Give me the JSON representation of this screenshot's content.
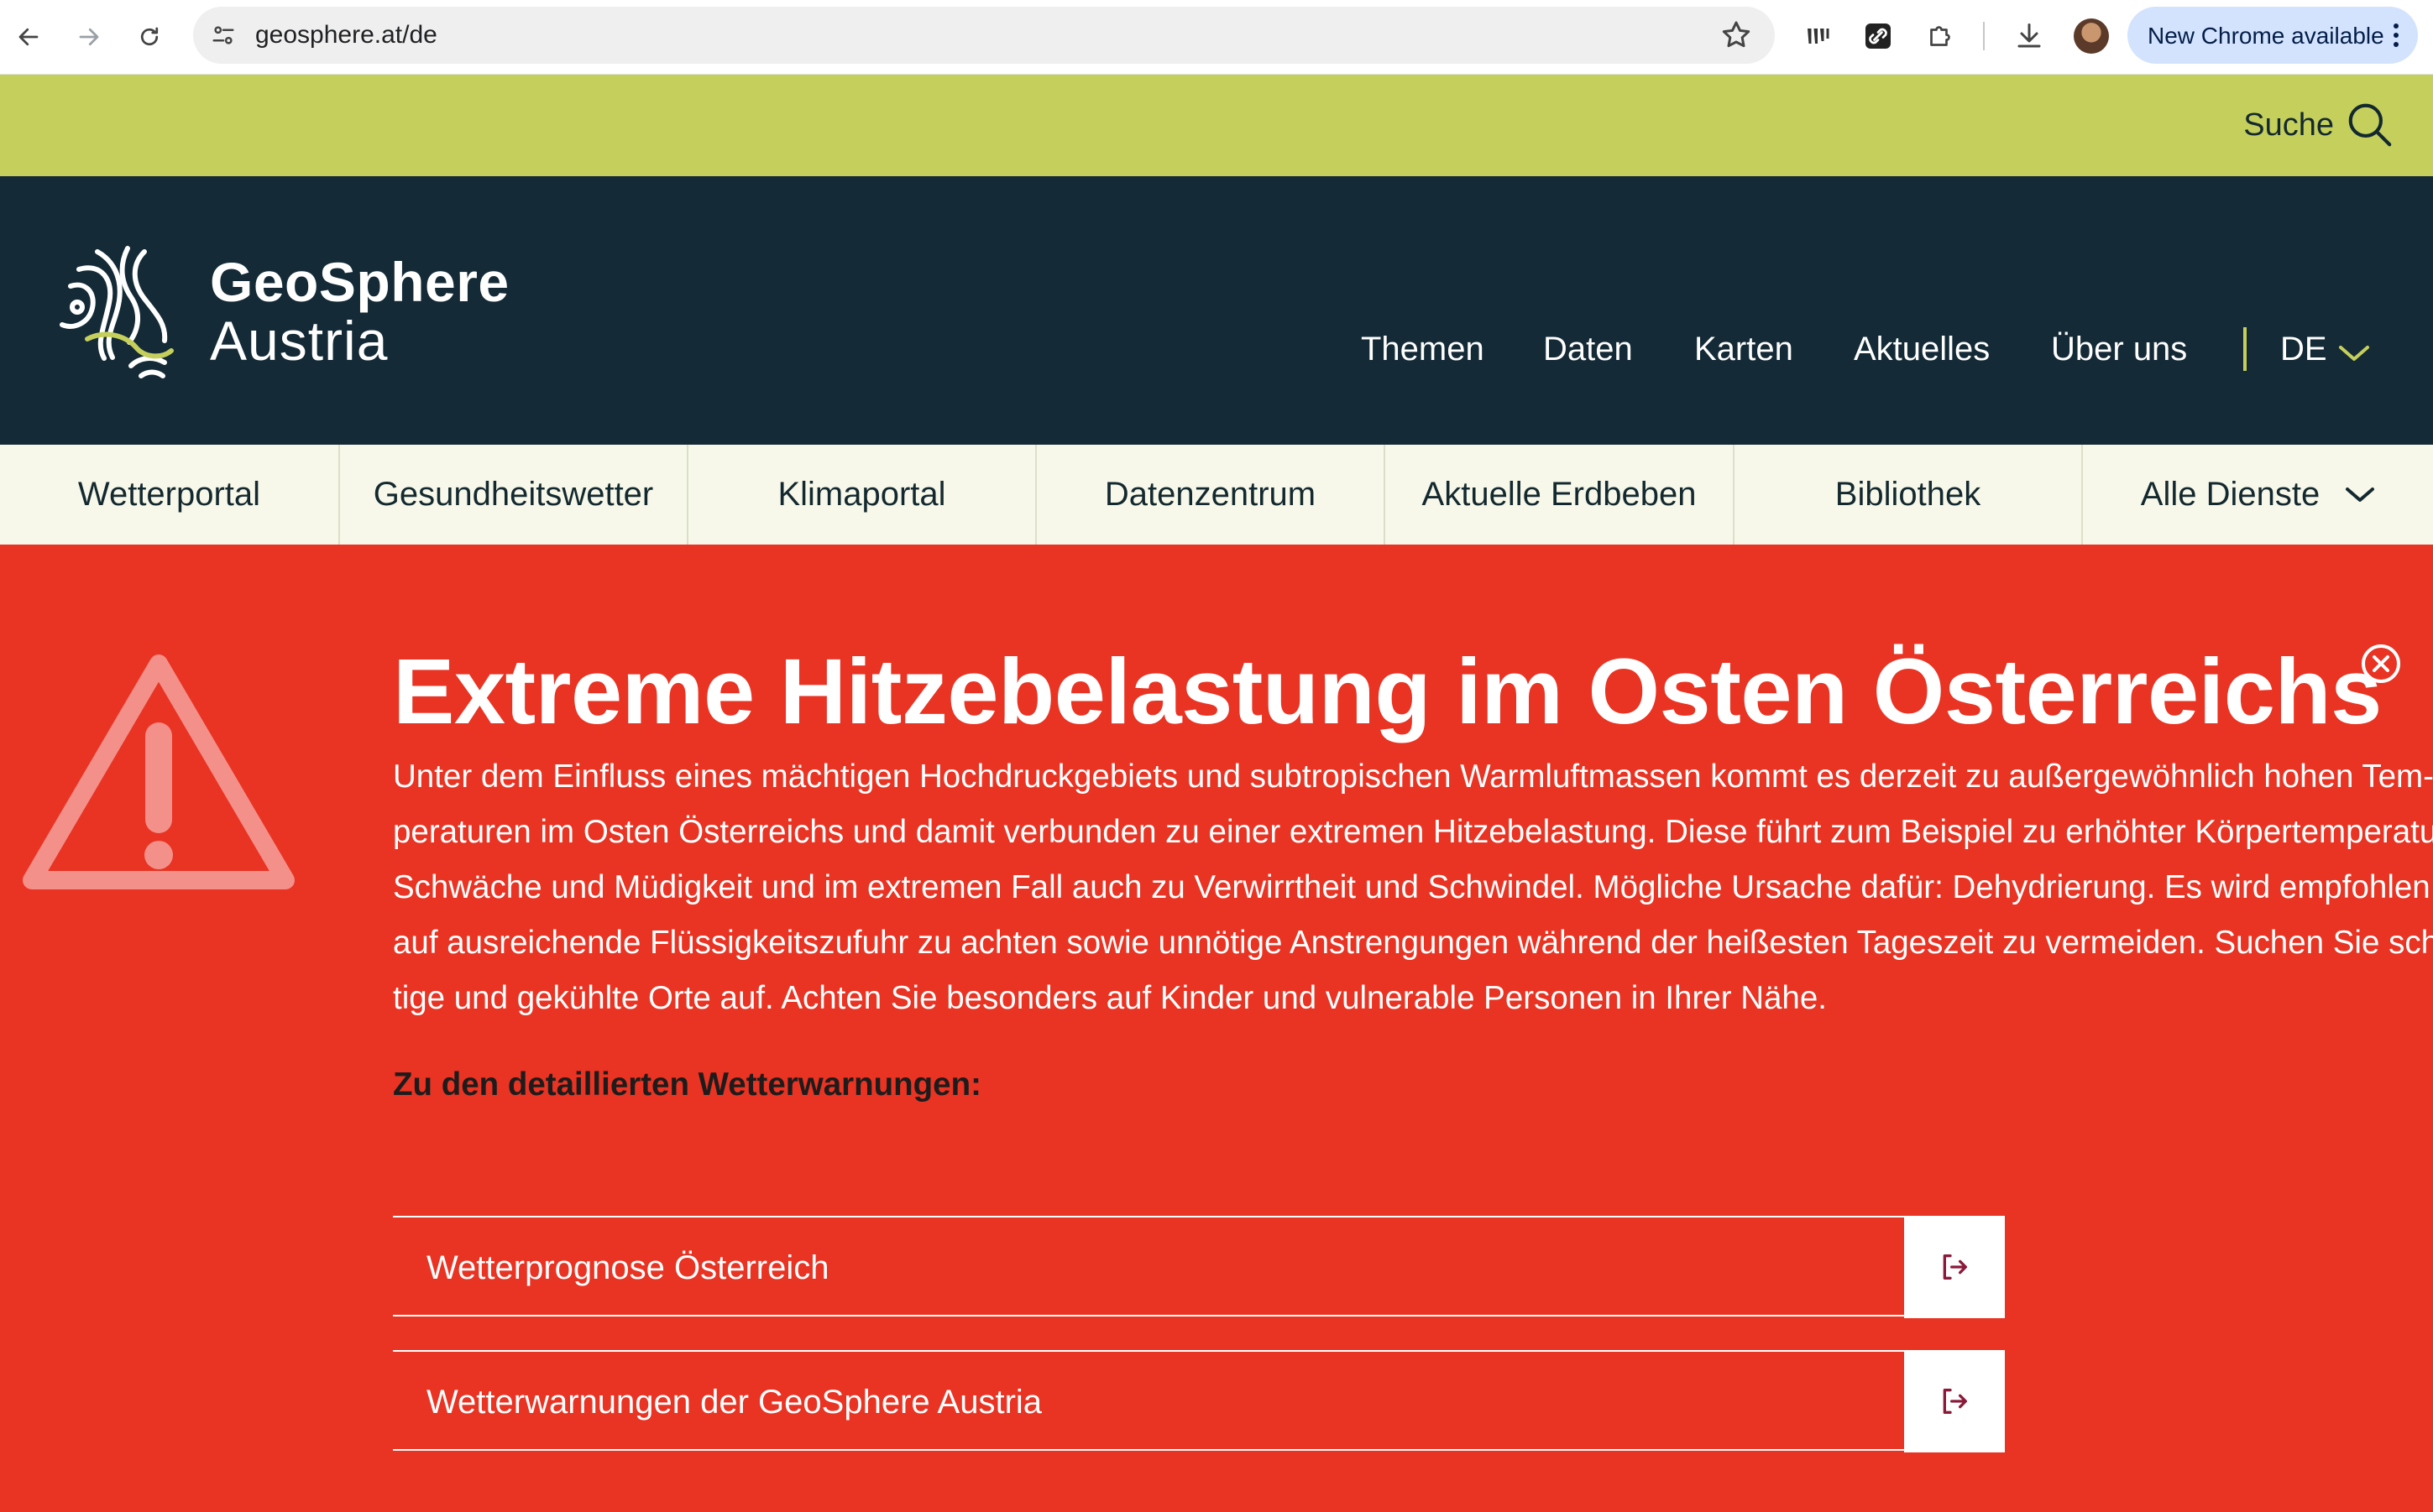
{
  "browser": {
    "url": "geosphere.at/de",
    "update_label": "New Chrome available"
  },
  "utility": {
    "search_label": "Suche"
  },
  "header": {
    "brand_line1": "GeoSphere",
    "brand_line2": "Austria",
    "nav": [
      "Themen",
      "Daten",
      "Karten",
      "Aktuelles",
      "Über uns"
    ],
    "language": "DE"
  },
  "services": [
    "Wetterportal",
    "Gesundheitswetter",
    "Klimaportal",
    "Datenzentrum",
    "Aktuelle Erdbeben",
    "Bibliothek",
    "Alle Dienste"
  ],
  "alert": {
    "title": "Extreme Hitzebelastung im Osten Österreichs",
    "body_lines": [
      "Unter dem Einfluss eines mächtigen Hochdruckgebiets und subtropischen Warmluftmassen kommt es derzeit zu außergewöhnlich hohen Tem-",
      "peraturen im Osten Österreichs und damit verbunden zu einer extremen Hitzebelastung. Diese führt zum Beispiel zu erhöhter Körpertemperatur,",
      "Schwäche und Müdigkeit und im extremen Fall auch zu Verwirrtheit und Schwindel. Mögliche Ursache dafür: Dehydrierung. Es wird empfohlen",
      "auf ausreichende Flüssigkeitszufuhr zu achten sowie unnötige Anstrengungen während der heißesten Tageszeit zu vermeiden. Suchen Sie schat-",
      "tige und gekühlte Orte auf. Achten Sie besonders auf Kinder und vulnerable Personen in Ihrer Nähe."
    ],
    "subheading": "Zu den detaillierten Wetterwarnungen:",
    "links": [
      "Wetterprognose Österreich",
      "Wetterwarnungen der GeoSphere Austria"
    ]
  },
  "colors": {
    "utility_bar": "#C5D05C",
    "header_bg": "#142A36",
    "services_bg": "#F7F8EA",
    "alert_red": "#E93323",
    "link_arrow": "#8B1A3A"
  },
  "icons": {
    "back": "back-arrow-icon",
    "forward": "forward-arrow-icon",
    "reload": "reload-icon",
    "site_settings": "site-settings-icon",
    "bookmark": "star-icon",
    "search": "search-icon",
    "language": "chevron-down-icon",
    "close": "close-circle-icon",
    "warning": "warning-triangle-icon",
    "external": "external-link-icon"
  }
}
